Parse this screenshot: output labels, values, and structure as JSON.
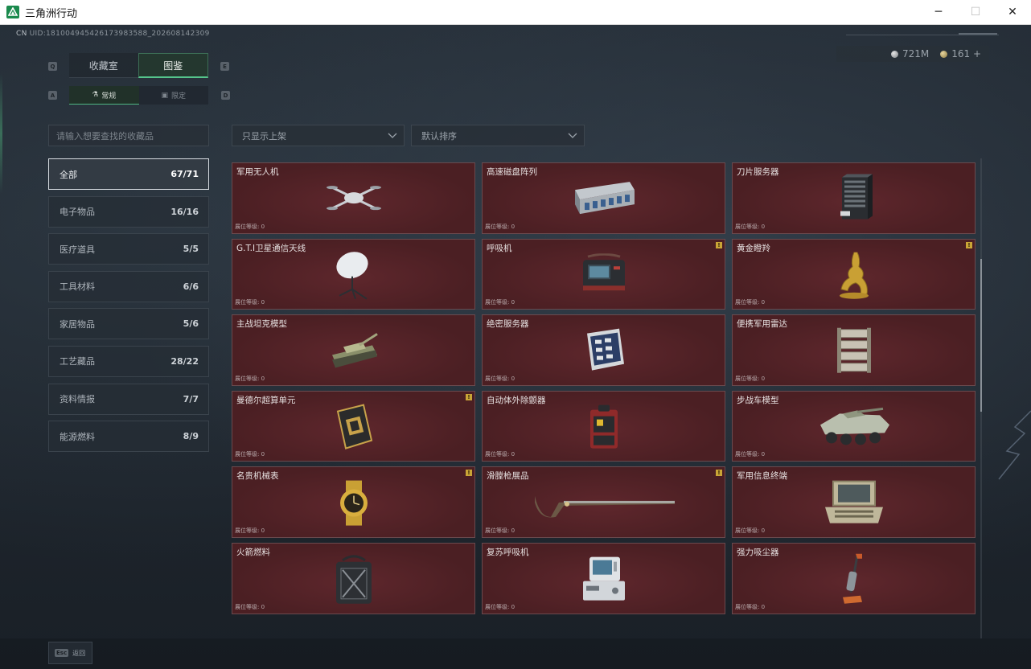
{
  "window": {
    "title": "三角洲行动",
    "minimize": "─",
    "maximize": "☐",
    "close": "✕"
  },
  "header": {
    "uid_prefix": "CN",
    "uid": "UID:181004945426173983588_202608142309",
    "currency": [
      {
        "icon": "silver-coin-icon",
        "value": "721M"
      },
      {
        "icon": "gold-coin-icon",
        "value": "161 +"
      }
    ]
  },
  "keys": {
    "q": "Q",
    "e": "E",
    "a": "A",
    "d": "D"
  },
  "tabs": [
    {
      "label": "收藏室",
      "active": false
    },
    {
      "label": "图鉴",
      "active": true
    }
  ],
  "subtabs": [
    {
      "label": "常规",
      "icon": "flask-icon",
      "active": true
    },
    {
      "label": "限定",
      "icon": "frame-icon",
      "active": false
    }
  ],
  "search": {
    "placeholder": "请输入想要查找的收藏品"
  },
  "filters": {
    "shelf": "只显示上架",
    "sort": "默认排序"
  },
  "categories": [
    {
      "label": "全部",
      "count": "67/71",
      "active": true
    },
    {
      "label": "电子物品",
      "count": "16/16"
    },
    {
      "label": "医疗道具",
      "count": "5/5"
    },
    {
      "label": "工具材料",
      "count": "6/6"
    },
    {
      "label": "家居物品",
      "count": "5/6"
    },
    {
      "label": "工艺藏品",
      "count": "28/22"
    },
    {
      "label": "资料情报",
      "count": "7/7"
    },
    {
      "label": "能源燃料",
      "count": "8/9"
    }
  ],
  "items": [
    {
      "name": "军用无人机",
      "level": "展位等级: 0",
      "badge": false,
      "icon": "drone-icon"
    },
    {
      "name": "高速磁盘阵列",
      "level": "展位等级: 0",
      "badge": false,
      "icon": "disk-array-icon"
    },
    {
      "name": "刀片服务器",
      "level": "展位等级: 0",
      "badge": false,
      "icon": "blade-server-icon"
    },
    {
      "name": "G.T.I卫星通信天线",
      "level": "展位等级: 0",
      "badge": false,
      "icon": "satellite-dish-icon"
    },
    {
      "name": "呼吸机",
      "level": "展位等级: 0",
      "badge": true,
      "icon": "ventilator-icon"
    },
    {
      "name": "黄金瞪羚",
      "level": "展位等级: 0",
      "badge": true,
      "icon": "golden-gazelle-icon"
    },
    {
      "name": "主战坦克模型",
      "level": "展位等级: 0",
      "badge": false,
      "icon": "tank-model-icon"
    },
    {
      "name": "绝密服务器",
      "level": "展位等级: 0",
      "badge": false,
      "icon": "secret-server-icon"
    },
    {
      "name": "便携军用雷达",
      "level": "展位等级: 0",
      "badge": false,
      "icon": "radar-icon"
    },
    {
      "name": "曼德尔超算单元",
      "level": "展位等级: 0",
      "badge": true,
      "icon": "compute-unit-icon"
    },
    {
      "name": "自动体外除颤器",
      "level": "展位等级: 0",
      "badge": false,
      "icon": "defibrillator-icon"
    },
    {
      "name": "步战车模型",
      "level": "展位等级: 0",
      "badge": false,
      "icon": "ifv-model-icon"
    },
    {
      "name": "名贵机械表",
      "level": "展位等级: 0",
      "badge": true,
      "icon": "watch-icon"
    },
    {
      "name": "滑膛枪展品",
      "level": "展位等级: 0",
      "badge": true,
      "icon": "musket-icon"
    },
    {
      "name": "军用信息终端",
      "level": "展位等级: 0",
      "badge": false,
      "icon": "terminal-icon"
    },
    {
      "name": "火箭燃料",
      "level": "展位等级: 0",
      "badge": false,
      "icon": "fuel-can-icon"
    },
    {
      "name": "复苏呼吸机",
      "level": "展位等级: 0",
      "badge": false,
      "icon": "resuscitator-icon"
    },
    {
      "name": "强力吸尘器",
      "level": "展位等级: 0",
      "badge": false,
      "icon": "vacuum-icon"
    }
  ],
  "badge_mark": "!",
  "footer": {
    "esc_key": "Esc",
    "esc_label": "返回"
  },
  "colors": {
    "accent": "#55c48b",
    "card_bg": "#4b1f23",
    "badge": "#c9a536"
  }
}
